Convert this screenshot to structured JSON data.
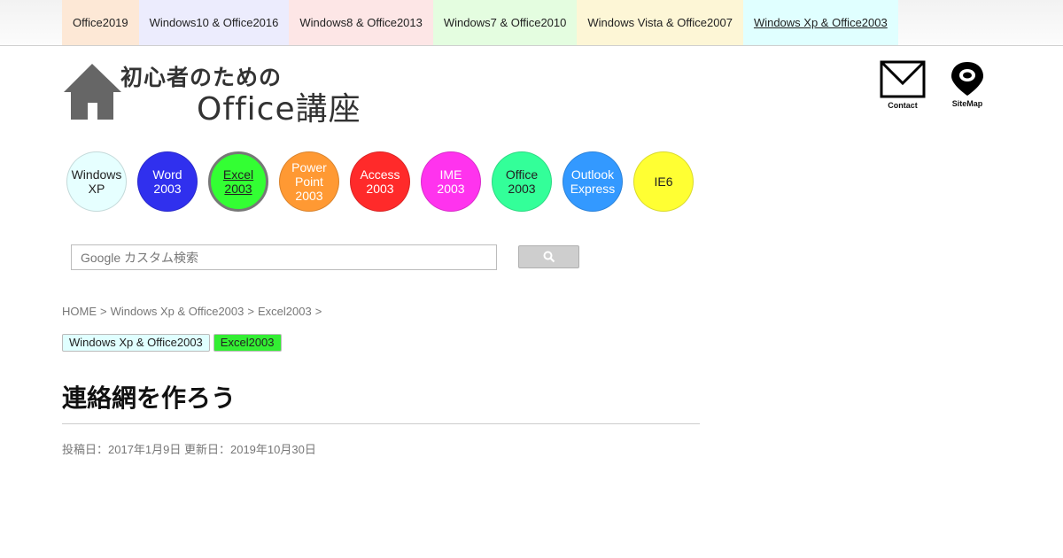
{
  "top_nav": [
    {
      "label": "Office2019",
      "bg": "#fde8d6",
      "active": false
    },
    {
      "label": "Windows10 & Office2016",
      "bg": "#ececfd",
      "active": false
    },
    {
      "label": "Windows8 & Office2013",
      "bg": "#fde6e6",
      "active": false
    },
    {
      "label": "Windows7 & Office2010",
      "bg": "#e4fde0",
      "active": false
    },
    {
      "label": "Windows Vista & Office2007",
      "bg": "#fdf6d6",
      "active": false
    },
    {
      "label": "Windows Xp & Office2003",
      "bg": "#e0ffff",
      "active": true
    }
  ],
  "logo": {
    "line1": "初心者のための",
    "line2": "Office講座"
  },
  "header_icons": {
    "contact": "Contact",
    "sitemap": "SiteMap"
  },
  "circle_nav": [
    {
      "lines": [
        "Windows",
        "XP"
      ],
      "bg": "#e6ffff",
      "color": "#222",
      "selected": false
    },
    {
      "lines": [
        "Word",
        "2003"
      ],
      "bg": "#3030ee",
      "color": "#ffffff",
      "selected": false
    },
    {
      "lines": [
        "Excel",
        "2003"
      ],
      "bg": "#33ff33",
      "color": "#222",
      "selected": true
    },
    {
      "lines": [
        "Power",
        "Point",
        "2003"
      ],
      "bg": "#ff9933",
      "color": "#ffffff",
      "selected": false
    },
    {
      "lines": [
        "Access",
        "2003"
      ],
      "bg": "#ff2a2a",
      "color": "#ffffff",
      "selected": false
    },
    {
      "lines": [
        "IME",
        "2003"
      ],
      "bg": "#ff33ee",
      "color": "#ffffff",
      "selected": false
    },
    {
      "lines": [
        "Office",
        "2003"
      ],
      "bg": "#33ff99",
      "color": "#222",
      "selected": false
    },
    {
      "lines": [
        "Outlook",
        "Express"
      ],
      "bg": "#3399ff",
      "color": "#ffffff",
      "selected": false
    },
    {
      "lines": [
        "IE6"
      ],
      "bg": "#ffff33",
      "color": "#222",
      "selected": false
    }
  ],
  "search": {
    "placeholder": "Google カスタム検索"
  },
  "breadcrumb": {
    "items": [
      "HOME",
      "Windows Xp & Office2003",
      "Excel2003"
    ],
    "separator": ">"
  },
  "tags": [
    {
      "label": "Windows Xp & Office2003",
      "bg": "#e0ffff"
    },
    {
      "label": "Excel2003",
      "bg": "#33ee33"
    }
  ],
  "article": {
    "title": "連絡網を作ろう",
    "meta": "投稿日：2017年1月9日 更新日：2019年10月30日"
  }
}
